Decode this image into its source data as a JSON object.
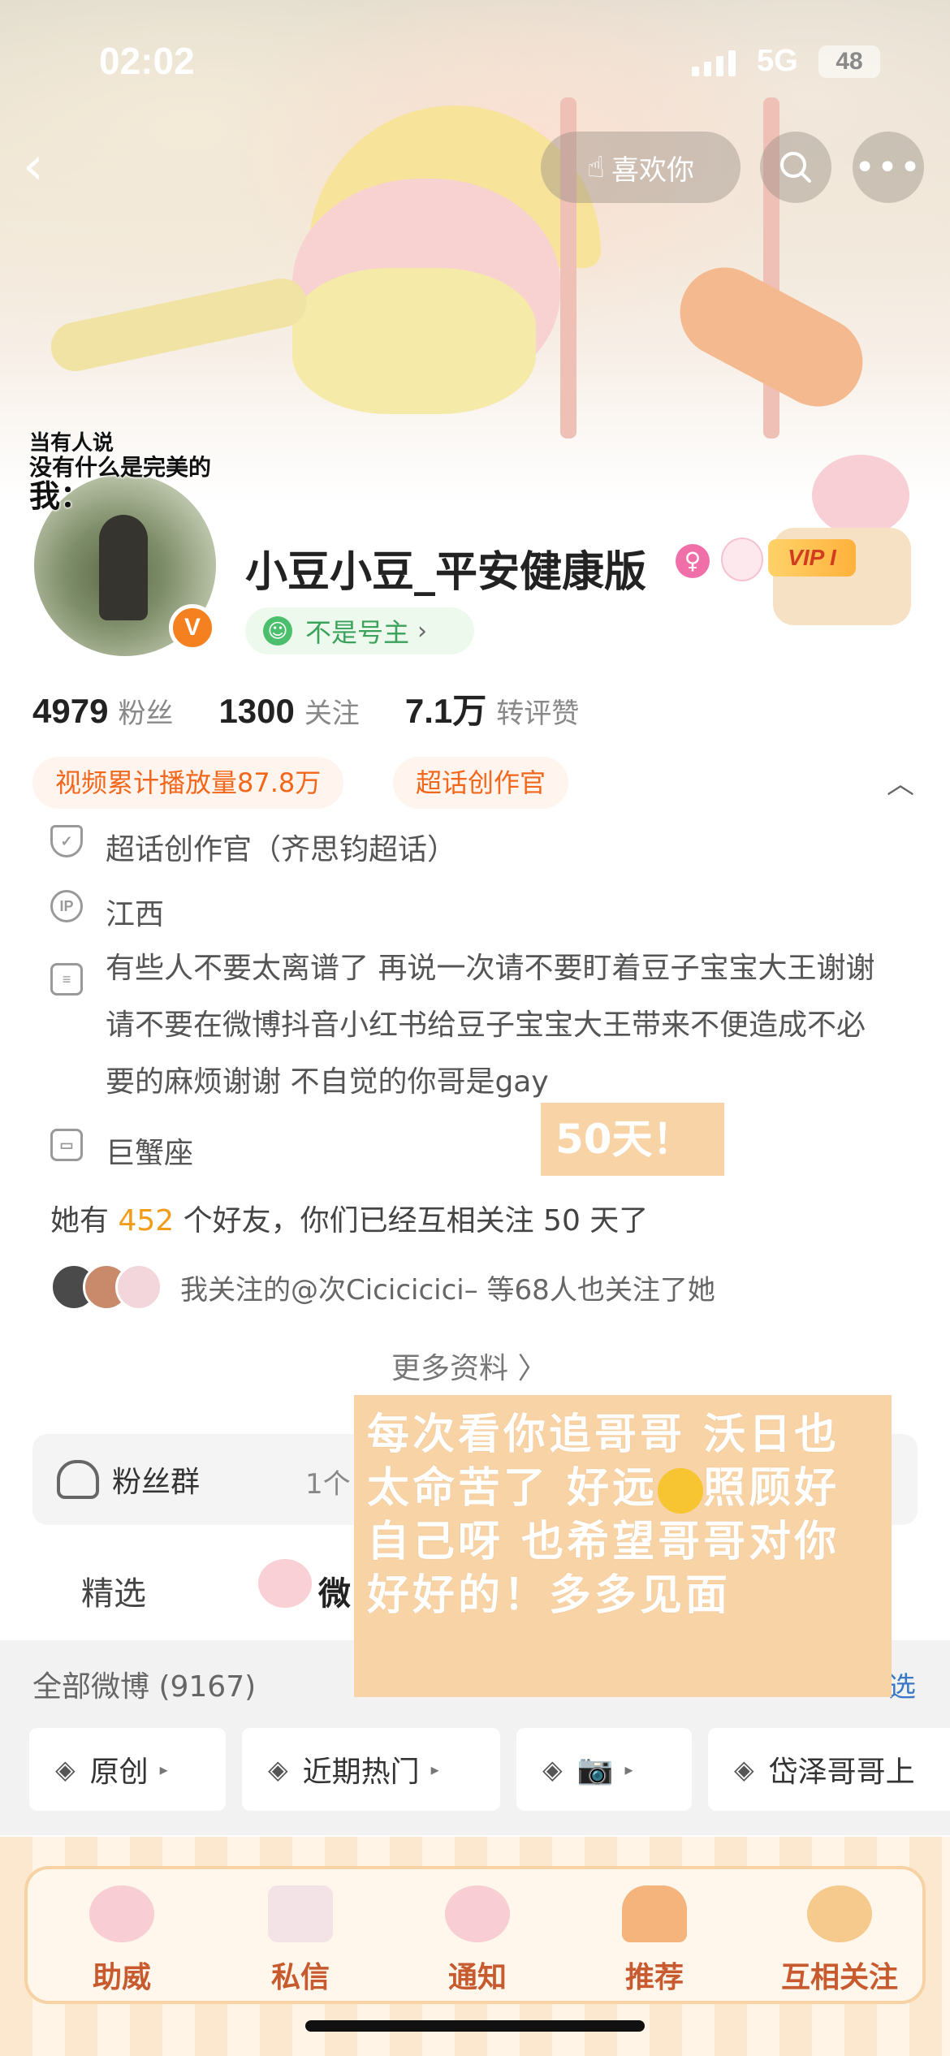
{
  "status_bar": {
    "time": "02:02",
    "network": "5G",
    "battery": "48"
  },
  "header": {
    "like_label": "喜欢你",
    "icons": [
      "back-arrow-icon",
      "hand-like-icon",
      "search-icon",
      "more-dots-icon"
    ]
  },
  "avatar": {
    "caption_line1": "当有人说",
    "caption_line2": "没有什么是完美的",
    "caption_line3": "我："
  },
  "profile": {
    "username": "小豆小豆_平安健康版",
    "vip_label": "VIP I",
    "verified_mark": "V",
    "not_owner_label": "不是号主"
  },
  "stats": [
    {
      "value": "4979",
      "label": "粉丝"
    },
    {
      "value": "1300",
      "label": "关注"
    },
    {
      "value": "7.1万",
      "label": "转评赞"
    }
  ],
  "tags": {
    "video": "视频累计播放量87.8万",
    "creator": "超话创作官"
  },
  "info": {
    "supertopic": "超话创作官（齐思钧超话）",
    "ip": "江西",
    "ip_icon_text": "IP",
    "bio": "有些人不要太离谱了 再说一次请不要盯着豆子宝宝大王谢谢 请不要在微博抖音小红书给豆子宝宝大王带来不便造成不必要的麻烦谢谢 不自觉的你哥是gay",
    "zodiac": "巨蟹座"
  },
  "friends": {
    "prefix": "她有 ",
    "count": "452",
    "suffix": " 个好友，你们已经互相关注 50 天了"
  },
  "mutual": {
    "text": "我关注的@次Cicicicici–  等68人也关注了她"
  },
  "more_info": "更多资料 〉",
  "fans_group": {
    "label": "粉丝群",
    "count": "1个"
  },
  "tabs": {
    "featured": "精选",
    "weibo": "微"
  },
  "weibo_list": {
    "all_label": "全部微博 (9167)",
    "filter_label": "选",
    "chips": [
      {
        "label": "原创"
      },
      {
        "label": "近期热门"
      },
      {
        "label": "📷"
      },
      {
        "label": "岱泽哥哥上"
      }
    ]
  },
  "stickers": {
    "days": "50天！",
    "message_part1": "每次看你追哥哥 沃日也太命苦了 好远",
    "message_part2": "照顾好自己呀 也希望哥哥对你好好的！多多见面"
  },
  "bottom_nav": [
    {
      "label": "助威"
    },
    {
      "label": "私信"
    },
    {
      "label": "通知"
    },
    {
      "label": "推荐"
    },
    {
      "label": "互相关注"
    }
  ]
}
